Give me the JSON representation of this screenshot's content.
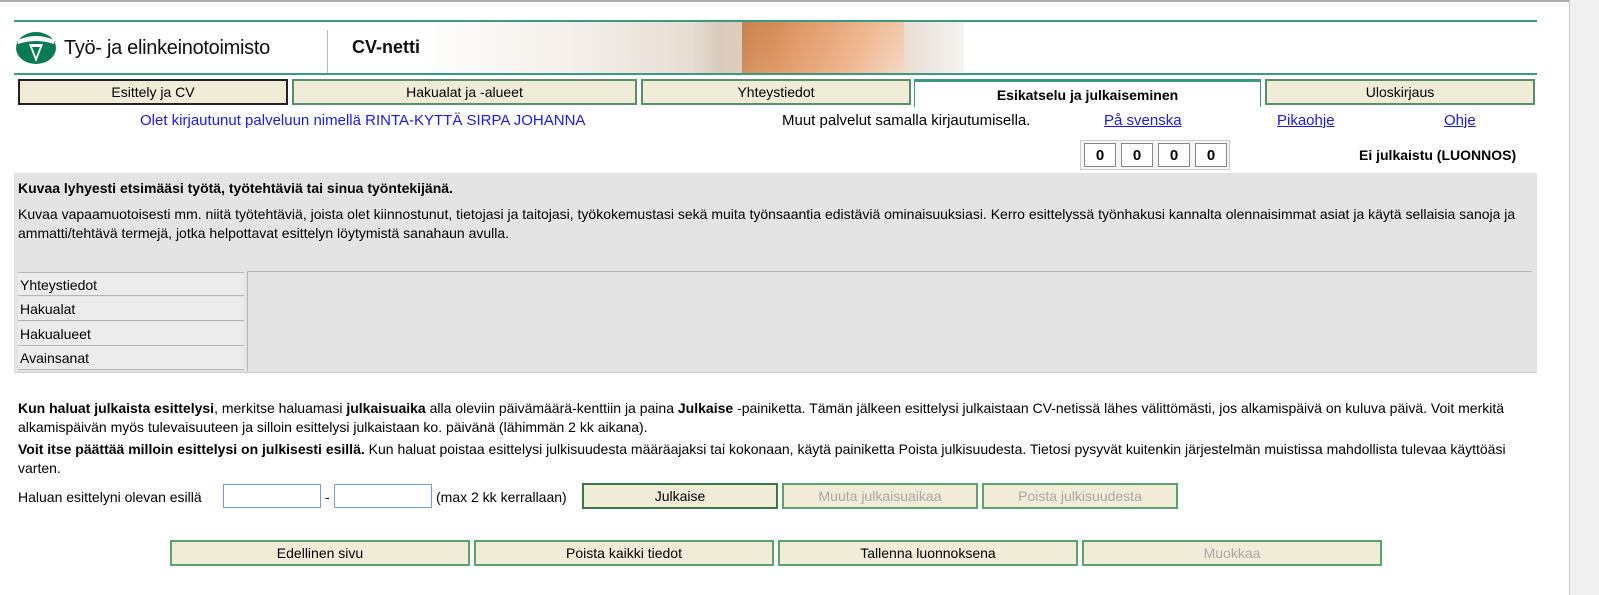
{
  "header": {
    "org_name": "Työ- ja elinkeinotoimisto",
    "app_title": "CV-netti"
  },
  "tabs": [
    {
      "label": "Esittely ja CV"
    },
    {
      "label": "Hakualat ja -alueet"
    },
    {
      "label": "Yhteystiedot"
    },
    {
      "label": "Esikatselu ja julkaiseminen",
      "active": true
    },
    {
      "label": "Uloskirjaus"
    }
  ],
  "user_bar": {
    "logged_in_text": "Olet kirjautunut palveluun nimellä RINTA-KYTTÄ SIRPA JOHANNA",
    "other_services_link": "Muut palvelut samalla kirjautumisella",
    "other_services_dot": ".",
    "swedish_link": "På svenska",
    "quick_help_link": "Pikaohje",
    "help_link": "Ohje"
  },
  "counter": {
    "digits": [
      "0",
      "0",
      "0",
      "0"
    ]
  },
  "status": "Ei julkaistu (LUONNOS)",
  "summary": {
    "title": "Kuvaa lyhyesti etsimääsi työtä, työtehtäviä tai sinua työntekijänä.",
    "description": "Kuvaa vapaamuotoisesti mm. niitä työtehtäviä, joista olet kiinnostunut, tietojasi ja taitojasi, työkokemustasi sekä muita työnsaantia edistäviä ominaisuuksiasi. Kerro esittelyssä työnhakusi kannalta olennaisimmat asiat ja käytä sellaisia sanoja ja ammatti/tehtävä termejä, jotka helpottavat esittelyn löytymistä sanahaun avulla.",
    "rows": [
      {
        "label": "Yhteystiedot"
      },
      {
        "label": "Hakualat"
      },
      {
        "label": "Hakualueet"
      },
      {
        "label": "Avainsanat"
      }
    ]
  },
  "publish_info": {
    "p1_bold1": "Kun haluat julkaista esittelysi",
    "p1_text1": ", merkitse haluamasi ",
    "p1_bold2": "julkaisuaika",
    "p1_text2": " alla oleviin päivämäärä-kenttiin ja paina ",
    "p1_bold3": "Julkaise",
    "p1_text3": " -painiketta. Tämän jälkeen esittelysi julkaistaan CV-netissä lähes välittömästi, jos alkamispäivä on kuluva päivä. Voit merkitä alkamispäivän myös tulevaisuuteen ja silloin esittelysi julkaistaan ko. päivänä (lähimmän 2 kk aikana).",
    "p2_bold": "Voit itse päättää milloin esittelysi on julkisesti esillä.",
    "p2_text": " Kun haluat poistaa esittelysi julkisuudesta määräajaksi tai kokonaan, käytä painiketta Poista julkisuudesta. Tietosi pysyvät kuitenkin järjestelmän muistissa mahdollista tulevaa käyttöäsi varten."
  },
  "publish_form": {
    "label": "Haluan esittelyni olevan esillä",
    "start_date": "",
    "end_date": "",
    "dash": "-",
    "max_note": "(max 2 kk kerrallaan)",
    "publish_button": "Julkaise",
    "change_button": "Muuta julkaisuaikaa",
    "remove_button": "Poista julkisuudesta"
  },
  "bottom_buttons": {
    "previous": "Edellinen sivu",
    "delete_all": "Poista kaikki tiedot",
    "save_draft": "Tallenna luonnoksena",
    "edit": "Muokkaa"
  }
}
